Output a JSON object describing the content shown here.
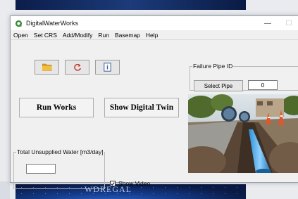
{
  "window": {
    "title": "DigitalWaterWorks",
    "minimize_glyph": "—",
    "maximize_glyph": "☐"
  },
  "menu": {
    "items": [
      "Open",
      "Set CRS",
      "Add/Modify",
      "Run",
      "Basemap",
      "Help"
    ]
  },
  "toolbar": {
    "open_icon": "folder-icon",
    "refresh_icon": "refresh-icon",
    "info_icon": "document-info-icon"
  },
  "buttons": {
    "run_works": "Run Works",
    "show_digital_twin": "Show Digital Twin"
  },
  "failure_pipe": {
    "legend": "Failure Pipe ID",
    "select_button": "Select Pipe",
    "value": "0"
  },
  "unsupplied": {
    "legend": "Total Unsupplied Water [m3/day]",
    "value": ""
  },
  "show_video": {
    "label": "Show Video",
    "checked": true
  },
  "background": {
    "banner_text": "WDREGAL"
  },
  "colors": {
    "accent_icon": "#e0a020",
    "refresh": "#c0392b",
    "app_icon": "#3c8d3c"
  }
}
